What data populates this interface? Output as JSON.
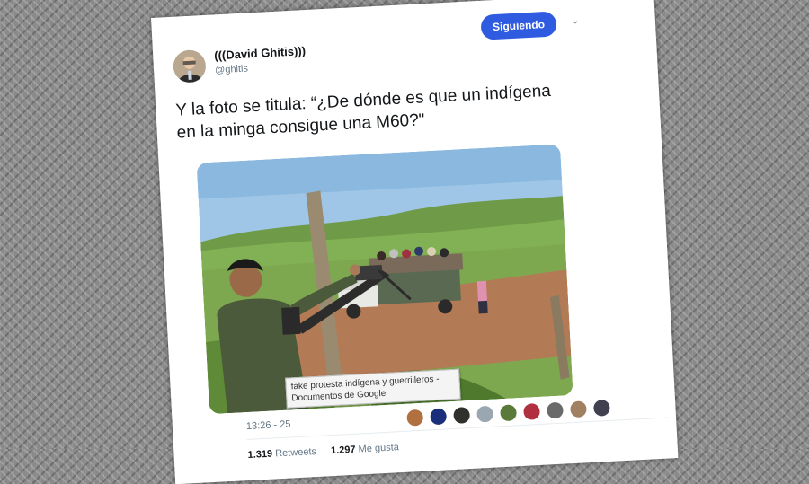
{
  "author": {
    "display_name": "(((David Ghitis)))",
    "handle": "@ghitis",
    "avatar": "avatar-photo-man-glasses"
  },
  "follow_button": {
    "label": "Siguiendo",
    "color": "#2f5be0"
  },
  "menu": {
    "icon": "chevron-down-icon",
    "glyph": "⌄"
  },
  "tweet": {
    "text": "Y la foto se titula: “¿De dónde es que un indígena en la minga consigue una M60?\""
  },
  "tooltip": {
    "text": "fake protesta indígena y guerrilleros - Documentos de Google"
  },
  "timestamp": "13:26 - 25",
  "stats": {
    "retweets_count": "1.319",
    "retweets_label": "Retweets",
    "likes_count": "1.297",
    "likes_label": "Me gusta"
  },
  "likers": [
    "#b07040",
    "#1a2f7a",
    "#30302c",
    "#9aa6b0",
    "#5a7a3a",
    "#b03040",
    "#6a6a6a",
    "#a08060",
    "#404050"
  ]
}
